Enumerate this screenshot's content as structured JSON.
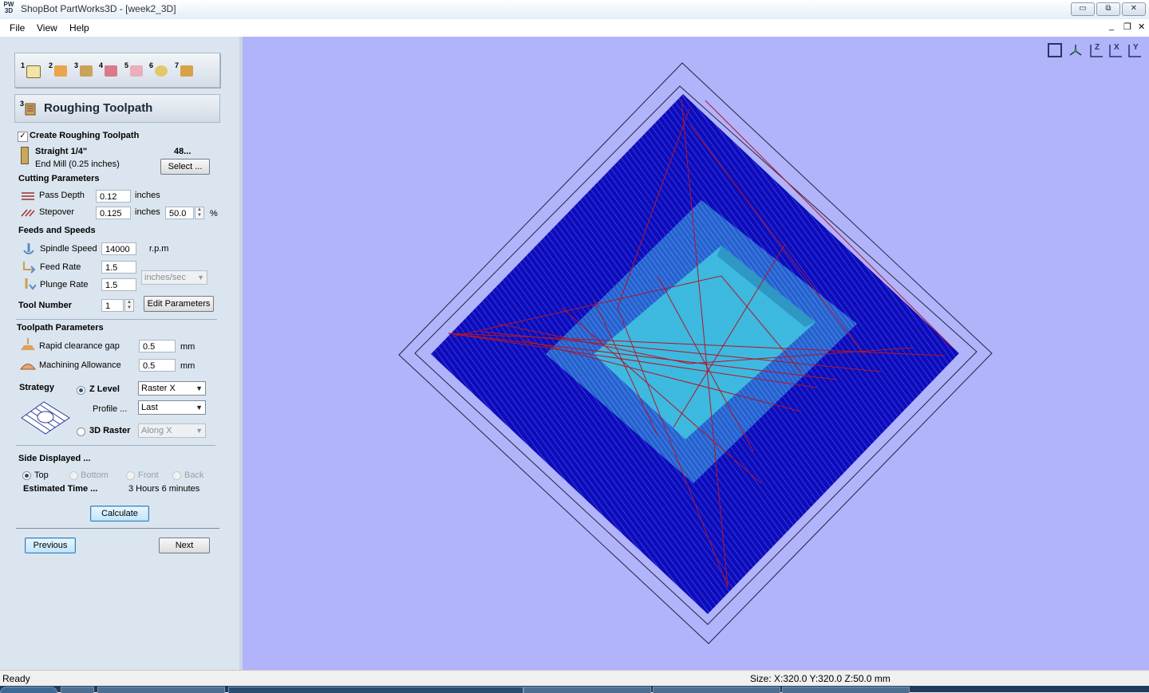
{
  "window": {
    "title": "ShopBot PartWorks3D - [week2_3D]",
    "logo_text": "PW 3D",
    "controls": [
      "▭",
      "⧉",
      "✕"
    ],
    "mdi_controls": [
      "_",
      "❐",
      "✕"
    ]
  },
  "menu": {
    "items": [
      "File",
      "View",
      "Help"
    ]
  },
  "panel": {
    "stages": [
      "1",
      "2",
      "3",
      "4",
      "5",
      "6",
      "7"
    ],
    "header_number": "3",
    "header_title": "Roughing Toolpath",
    "create_label": "Create Roughing Toolpath",
    "create_checked": true,
    "tool": {
      "name": "Straight 1/4\"",
      "description": "End Mill (0.25 inches)",
      "number_short": "48...",
      "select_label": "Select ..."
    },
    "cutting": {
      "title": "Cutting Parameters",
      "pass_depth_label": "Pass Depth",
      "pass_depth_value": "0.12",
      "pass_depth_unit": "inches",
      "stepover_label": "Stepover",
      "stepover_value": "0.125",
      "stepover_unit": "inches",
      "stepover_percent": "50.0",
      "percent_sign": "%"
    },
    "feeds": {
      "title": "Feeds and Speeds",
      "spindle_label": "Spindle Speed",
      "spindle_value": "14000",
      "spindle_unit": "r.p.m",
      "feed_label": "Feed Rate",
      "feed_value": "1.5",
      "plunge_label": "Plunge Rate",
      "plunge_value": "1.5",
      "rate_unit": "inches/sec",
      "tool_number_label": "Tool Number",
      "tool_number_value": "1",
      "edit_label": "Edit Parameters"
    },
    "toolpath": {
      "title": "Toolpath Parameters",
      "rapid_label": "Rapid clearance gap",
      "rapid_value": "0.5",
      "rapid_unit": "mm",
      "allowance_label": "Machining Allowance",
      "allowance_value": "0.5",
      "allowance_unit": "mm"
    },
    "strategy": {
      "title": "Strategy",
      "zlevel_label": "Z Level",
      "zlevel_selected": true,
      "zlevel_option": "Raster X",
      "profile_label": "Profile ...",
      "profile_option": "Last",
      "raster_label": "3D Raster",
      "raster_option": "Along X"
    },
    "side": {
      "title": "Side Displayed ...",
      "options": [
        "Top",
        "Bottom",
        "Front",
        "Back"
      ],
      "selected": "Top",
      "estimated_label": "Estimated Time ...",
      "estimated_value": "3 Hours 6 minutes"
    },
    "calculate_label": "Calculate",
    "previous_label": "Previous",
    "next_label": "Next"
  },
  "viewport": {
    "background": "#b1b3fb",
    "view_icons": [
      "fit-view-icon",
      "iso-view-icon",
      "z-view-icon",
      "x-view-icon",
      "y-view-icon"
    ],
    "axis_letters": [
      "Z",
      "X",
      "Y"
    ]
  },
  "status": {
    "left": "Ready",
    "right": "Size: X:320.0 Y:320.0 Z:50.0 mm"
  }
}
